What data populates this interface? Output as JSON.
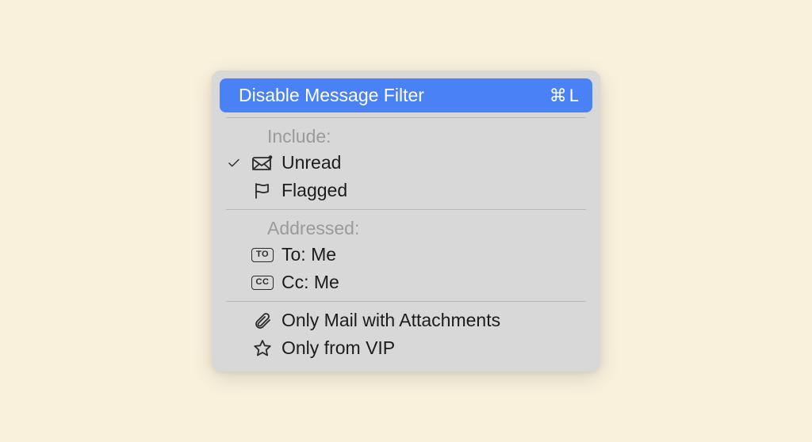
{
  "primary": {
    "label": "Disable Message Filter",
    "shortcut_key": "L",
    "shortcut_symbol": "⌘"
  },
  "sections": {
    "include": {
      "header": "Include:",
      "items": {
        "unread": {
          "label": "Unread",
          "checked": true
        },
        "flagged": {
          "label": "Flagged",
          "checked": false
        }
      }
    },
    "addressed": {
      "header": "Addressed:",
      "items": {
        "to_me": {
          "label": "To: Me",
          "badge": "TO"
        },
        "cc_me": {
          "label": "Cc: Me",
          "badge": "CC"
        }
      }
    },
    "other": {
      "items": {
        "attachments": {
          "label": "Only Mail with Attachments"
        },
        "vip": {
          "label": "Only from VIP"
        }
      }
    }
  }
}
